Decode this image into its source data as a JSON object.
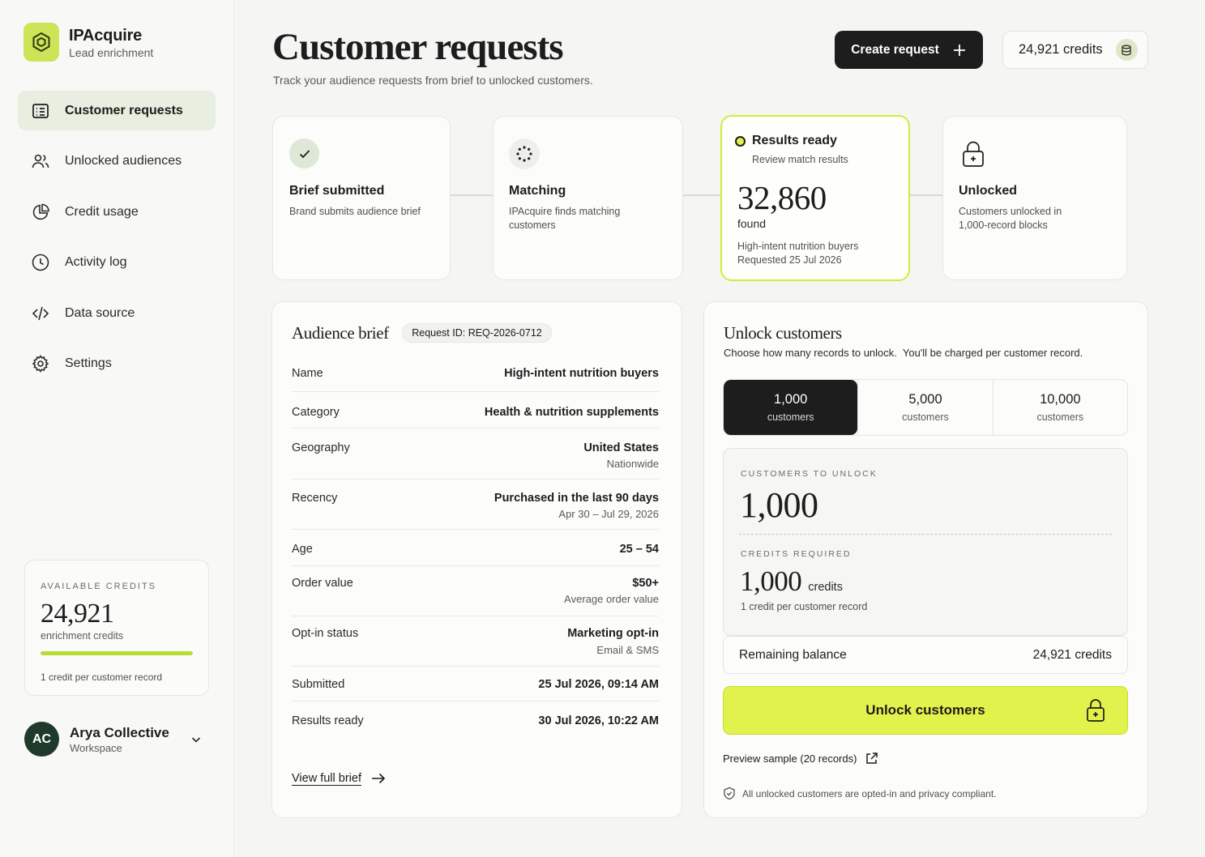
{
  "brand": {
    "name": "IPAcquire",
    "subtitle": "Lead enrichment",
    "logo_icon": "hexagon-logo-icon",
    "logo_color": "#cde456"
  },
  "sidebar": {
    "items": [
      {
        "label": "Customer requests",
        "icon": "list-icon",
        "active": true
      },
      {
        "label": "Unlocked audiences",
        "icon": "users-icon",
        "active": false
      },
      {
        "label": "Credit usage",
        "icon": "pie-chart-icon",
        "active": false
      },
      {
        "label": "Activity log",
        "icon": "clock-icon",
        "active": false
      },
      {
        "label": "Data source",
        "icon": "code-icon",
        "active": false
      },
      {
        "label": "Settings",
        "icon": "gear-icon",
        "active": false
      }
    ],
    "credits": {
      "eyebrow": "AVAILABLE CREDITS",
      "value": "24,921",
      "unit": "enrichment credits",
      "progress_fraction": 1.0,
      "note": "1 credit per customer record"
    },
    "workspace": {
      "initials": "AC",
      "name": "Arya Collective",
      "label": "Workspace"
    }
  },
  "header": {
    "title": "Customer requests",
    "subtitle": "Track your audience requests from brief to unlocked customers.",
    "create_label": "Create request",
    "credits_label": "24,921 credits"
  },
  "steps": [
    {
      "title": "Brief submitted",
      "desc": "Brand submits audience brief",
      "icon": "check-icon",
      "state": "done"
    },
    {
      "title": "Matching",
      "desc": "IPAcquire finds matching customers",
      "icon": "spinner-icon",
      "state": "done"
    },
    {
      "title": "Results ready",
      "desc": "Review match results",
      "count": "32,860",
      "count_label": "found",
      "audience": "High-intent nutrition buyers",
      "requested": "Requested 25 Jul 2026",
      "state": "active"
    },
    {
      "title": "Unlocked",
      "desc": "Customers unlocked in 1,000-record blocks",
      "icon": "lock-icon",
      "state": "pending"
    }
  ],
  "brief": {
    "title": "Audience brief",
    "request_id": "Request ID: REQ-2026-0712",
    "rows": [
      {
        "key": "Name",
        "value": "High-intent nutrition buyers",
        "detail": ""
      },
      {
        "key": "Category",
        "value": "Health & nutrition supplements",
        "detail": ""
      },
      {
        "key": "Geography",
        "value": "United States",
        "detail": "Nationwide"
      },
      {
        "key": "Recency",
        "value": "Purchased in the last 90 days",
        "detail": "Apr 30 – Jul 29, 2026"
      },
      {
        "key": "Age",
        "value": "25 – 54",
        "detail": ""
      },
      {
        "key": "Order value",
        "value": "$50+",
        "detail": "Average order value"
      },
      {
        "key": "Opt-in status",
        "value": "Marketing opt-in",
        "detail": "Email & SMS"
      },
      {
        "key": "Submitted",
        "value": "25 Jul 2026, 09:14 AM",
        "detail": ""
      },
      {
        "key": "Results ready",
        "value": "30 Jul 2026, 10:22 AM",
        "detail": ""
      }
    ],
    "link_label": "View full brief"
  },
  "unlock": {
    "title": "Unlock customers",
    "subtitle": "Choose how many records to unlock.  You'll be charged per customer record.",
    "options": [
      {
        "count": "1,000",
        "unit": "customers",
        "selected": true
      },
      {
        "count": "5,000",
        "unit": "customers",
        "selected": false
      },
      {
        "count": "10,000",
        "unit": "customers",
        "selected": false
      }
    ],
    "to_unlock_label": "CUSTOMERS TO UNLOCK",
    "to_unlock_value": "1,000",
    "credits_required_label": "CREDITS REQUIRED",
    "credits_required_value": "1,000",
    "credits_unit": "credits",
    "credits_note": "1 credit per customer record",
    "remaining_label": "Remaining balance",
    "remaining_value": "24,921 credits",
    "button_label": "Unlock customers",
    "preview_label": "Preview sample (20 records)",
    "compliance": "All unlocked customers are opted-in and privacy compliant."
  },
  "colors": {
    "accent": "#e2f24c",
    "dark": "#1c1d1c",
    "active_nav": "#e8eee0"
  }
}
